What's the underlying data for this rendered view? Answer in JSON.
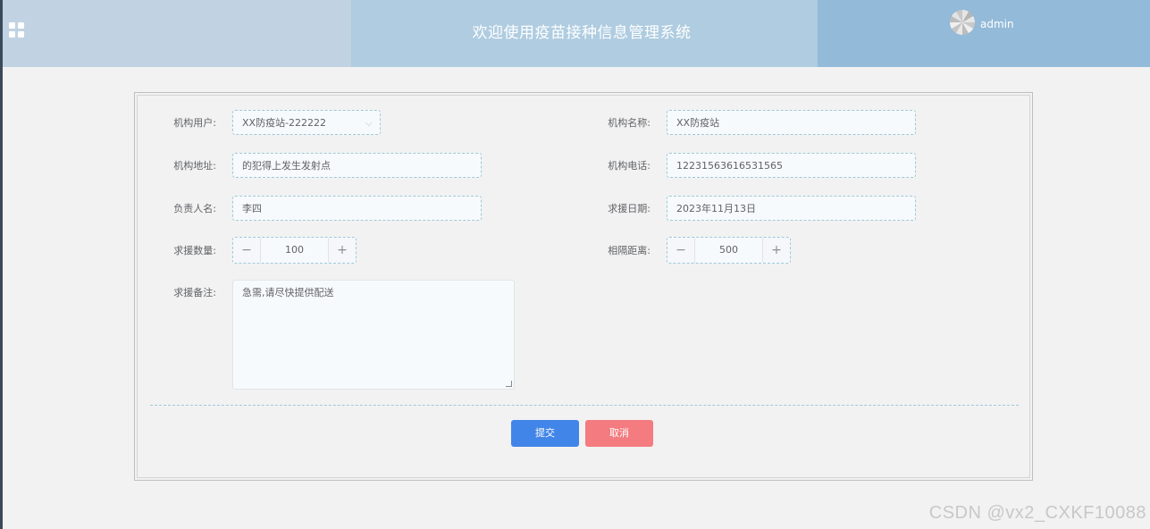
{
  "header": {
    "title": "欢迎使用疫苗接种信息管理系统",
    "menu_icon": "grid-icon",
    "avatar_icon": "avatar-icon",
    "username": "admin",
    "colors": [
      "#c1d3e3",
      "#afcce0",
      "#93bad8"
    ]
  },
  "form": {
    "org_user": {
      "label": "机构用户:",
      "value": "XX防疫站-222222"
    },
    "org_name": {
      "label": "机构名称:",
      "value": "XX防疫站"
    },
    "org_address": {
      "label": "机构地址:",
      "value": "的犯得上发生发射点"
    },
    "org_phone": {
      "label": "机构电话:",
      "value": "12231563616531565"
    },
    "contact_name": {
      "label": "负责人名:",
      "value": "李四"
    },
    "rescue_date": {
      "label": "求援日期:",
      "value": "2023年11月13日"
    },
    "rescue_count": {
      "label": "求援数量:",
      "value": "100"
    },
    "distance": {
      "label": "相隔距离:",
      "value": "500"
    },
    "notes": {
      "label": "求援备注:",
      "value": "急需,请尽快提供配送"
    },
    "stepper_minus": "−",
    "stepper_plus": "+"
  },
  "actions": {
    "submit_label": "提交",
    "cancel_label": "取消",
    "submit_color": "#4285e8",
    "cancel_color": "#f47b7f"
  },
  "watermark": "CSDN @vx2_CXKF10088"
}
